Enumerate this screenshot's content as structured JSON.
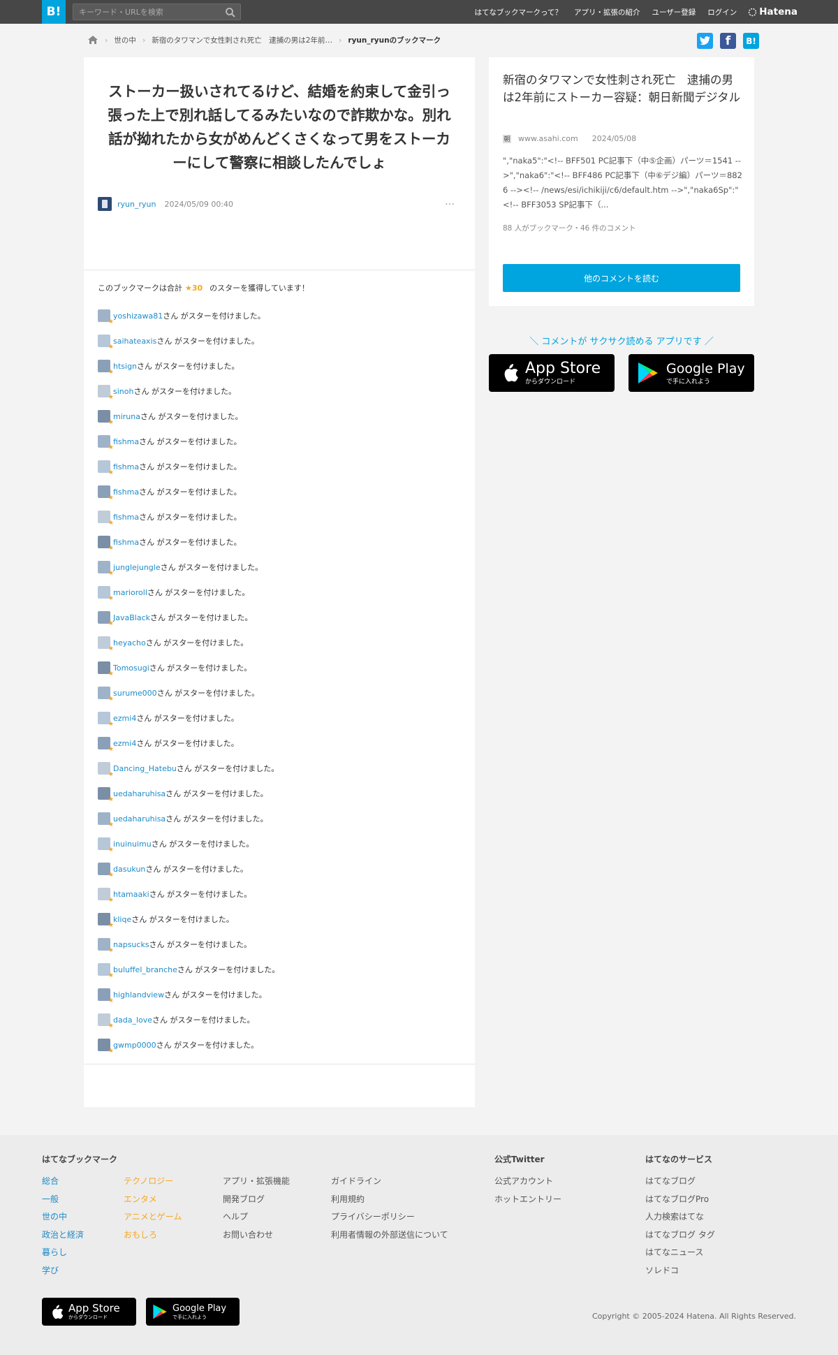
{
  "header": {
    "logo": "B!",
    "search_placeholder": "キーワード・URLを検索",
    "nav": [
      "はてなブックマークって？",
      "アプリ・拡張の紹介",
      "ユーザー登録",
      "ログイン"
    ],
    "hatena": "Hatena"
  },
  "breadcrumb": {
    "items": [
      "世の中",
      "新宿のタワマンで女性刺され死亡　逮捕の男は2年前…",
      "ryun_ryunのブックマーク"
    ]
  },
  "share": {
    "twitter": "t",
    "facebook": "f",
    "hatena": "B!"
  },
  "comment": {
    "text": "ストーカー扱いされてるけど、結婚を約束して金引っ張った上で別れ話してるみたいなので詐欺かな。別れ話が拗れたから女がめんどくさくなって男をストーカーにして警察に相談したんでしょ",
    "user": "ryun_ryun",
    "timestamp": "2024/05/09 00:40",
    "more": "…"
  },
  "stars": {
    "summary_prefix": "このブックマークは合計",
    "count": "★30",
    "summary_suffix": "のスターを獲得しています！",
    "suffix_text": "さん がスターを付けました。",
    "users": [
      "yoshizawa81",
      "saihateaxis",
      "htsign",
      "sinoh",
      "miruna",
      "fishma",
      "fishma",
      "fishma",
      "fishma",
      "fishma",
      "junglejungle",
      "marioroll",
      "JavaBlack",
      "heyacho",
      "Tomosugi",
      "surume000",
      "ezmi4",
      "ezmi4",
      "Dancing_Hatebu",
      "uedaharuhisa",
      "uedaharuhisa",
      "inuinuimu",
      "dasukun",
      "htamaaki",
      "kliqe",
      "napsucks",
      "buluffel_branche",
      "highlandview",
      "dada_love",
      "gwmp0000"
    ]
  },
  "entry": {
    "title": "新宿のタワマンで女性刺され死亡　逮捕の男は2年前にストーカー容疑：朝日新聞デジタル",
    "domain": "www.asahi.com",
    "date": "2024/05/08",
    "description": "\",\"naka5\":\"<!-- BFF501 PC記事下（中⑤企画）パーツ＝1541 -->\",\"naka6\":\"<!-- BFF486 PC記事下（中⑥デジ編）パーツ＝8826 --><!-- /news/esi/ichikiji/c6/default.htm -->\",\"naka6Sp\":\"<!-- BFF3053 SP記事下（...",
    "stats": "88 人がブックマーク・46 件のコメント",
    "more_button": "他のコメントを読む"
  },
  "promo": {
    "text": "＼ コメントが サクサク読める アプリです ／",
    "appstore_big": "App Store",
    "appstore_small": "からダウンロード",
    "googleplay_big": "Google Play",
    "googleplay_small": "で手に入れよう"
  },
  "footer": {
    "col1_title": "はてなブックマーク",
    "cat1": [
      "総合",
      "一般",
      "世の中",
      "政治と経済",
      "暮らし",
      "学び"
    ],
    "cat2": [
      "テクノロジー",
      "エンタメ",
      "アニメとゲーム",
      "おもしろ"
    ],
    "links3": [
      "アプリ・拡張機能",
      "開発ブログ",
      "ヘルプ",
      "お問い合わせ"
    ],
    "links4": [
      "ガイドライン",
      "利用規約",
      "プライバシーポリシー",
      "利用者情報の外部送信について"
    ],
    "twitter_title": "公式Twitter",
    "twitter_links": [
      "公式アカウント",
      "ホットエントリー"
    ],
    "services_title": "はてなのサービス",
    "services": [
      "はてなブログ",
      "はてなブログPro",
      "人力検索はてな",
      "はてなブログ タグ",
      "はてなニュース",
      "ソレドコ"
    ],
    "copyright": "Copyright © 2005-2024 Hatena. All Rights Reserved."
  },
  "colors": {
    "accent": "#00a4de",
    "link": "#1c8bc9",
    "star": "#f5a623",
    "header_bg": "#474747"
  }
}
